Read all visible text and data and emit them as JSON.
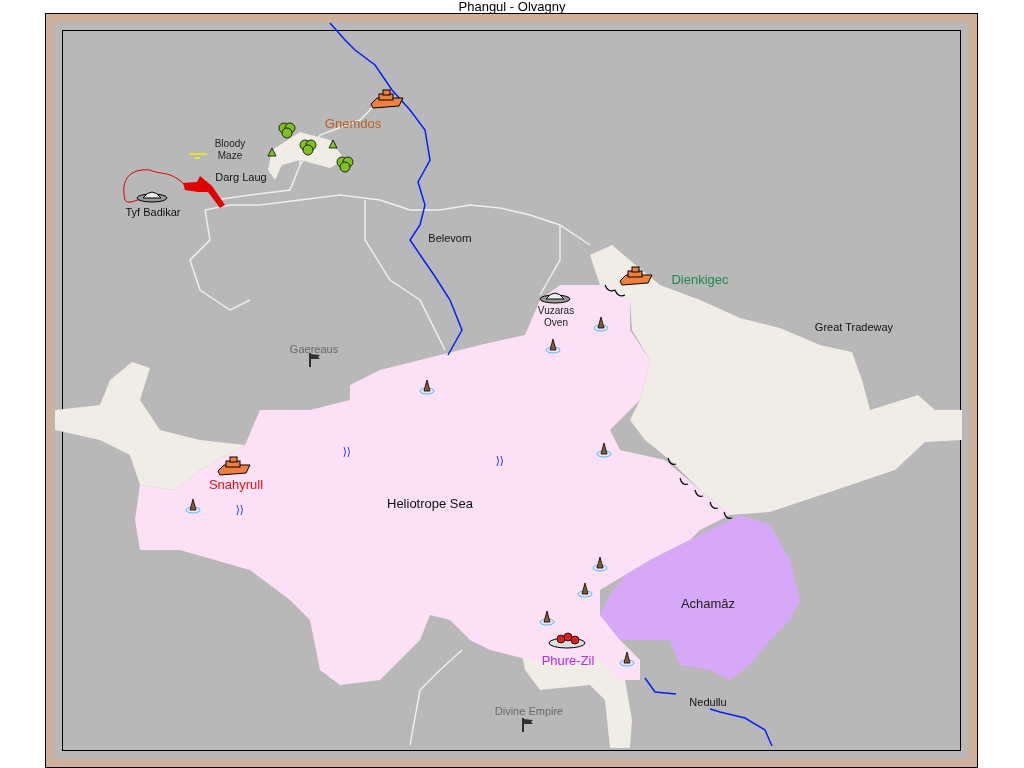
{
  "title": "Phangul - Olvagny",
  "labels": [
    {
      "text": "Gnemdos",
      "kind": "city",
      "color": "#b8602a"
    },
    {
      "text": "Bloody Maze",
      "kind": "minor",
      "color": "#202020"
    },
    {
      "text": "Darg Laug",
      "kind": "site",
      "color": "#101010"
    },
    {
      "text": "Tyf Badikar",
      "kind": "site",
      "color": "#101010"
    },
    {
      "text": "Belevorn",
      "kind": "site",
      "color": "#101010"
    },
    {
      "text": "Dienkigec",
      "kind": "city",
      "color": "#1a8a4a"
    },
    {
      "text": "Vuzaras Oven",
      "kind": "minor",
      "color": "#202020"
    },
    {
      "text": "Great Tradeway",
      "kind": "site",
      "color": "#101010"
    },
    {
      "text": "Gaereaus",
      "kind": "site",
      "color": "#686868"
    },
    {
      "text": "Snahyrull",
      "kind": "city",
      "color": "#e81010"
    },
    {
      "text": "Heliotrope Sea",
      "kind": "region",
      "color": "#101010"
    },
    {
      "text": "Achamâz",
      "kind": "region",
      "color": "#202020"
    },
    {
      "text": "Phure-Zil",
      "kind": "city",
      "color": "#b030e0"
    },
    {
      "text": "Nedullu",
      "kind": "site",
      "color": "#101010"
    },
    {
      "text": "Divine Empire",
      "kind": "site",
      "color": "#686868"
    }
  ]
}
